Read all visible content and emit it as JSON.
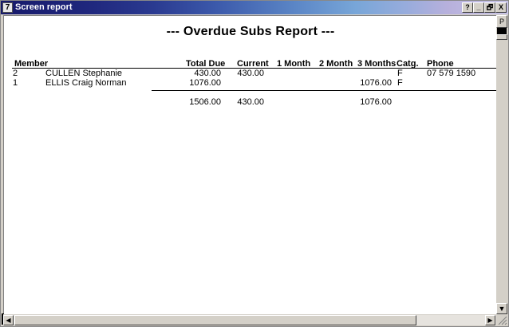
{
  "window": {
    "title": "Screen report",
    "app_icon_glyph": "7",
    "buttons": [
      "?",
      "_",
      "🗗",
      "X"
    ]
  },
  "report": {
    "title": "---  Overdue Subs Report  ---",
    "columns": {
      "member": "Member",
      "total_due": "Total Due",
      "current": "Current",
      "m1": "1 Month",
      "m2": "2 Month",
      "m3": "3 Months",
      "catg": "Catg.",
      "phone": "Phone"
    },
    "rows": [
      {
        "id": "2",
        "name": "CULLEN Stephanie",
        "total_due": "430.00",
        "current": "430.00",
        "m1": "",
        "m2": "",
        "m3": "",
        "catg": "F",
        "phone": "07 579 1590"
      },
      {
        "id": "1",
        "name": "ELLIS Craig Norman",
        "total_due": "1076.00",
        "current": "",
        "m1": "",
        "m2": "",
        "m3": "1076.00",
        "catg": "F",
        "phone": ""
      }
    ],
    "totals": {
      "total_due": "1506.00",
      "current": "430.00",
      "m3": "1076.00"
    }
  },
  "scrollbar": {
    "top_label": "P"
  }
}
